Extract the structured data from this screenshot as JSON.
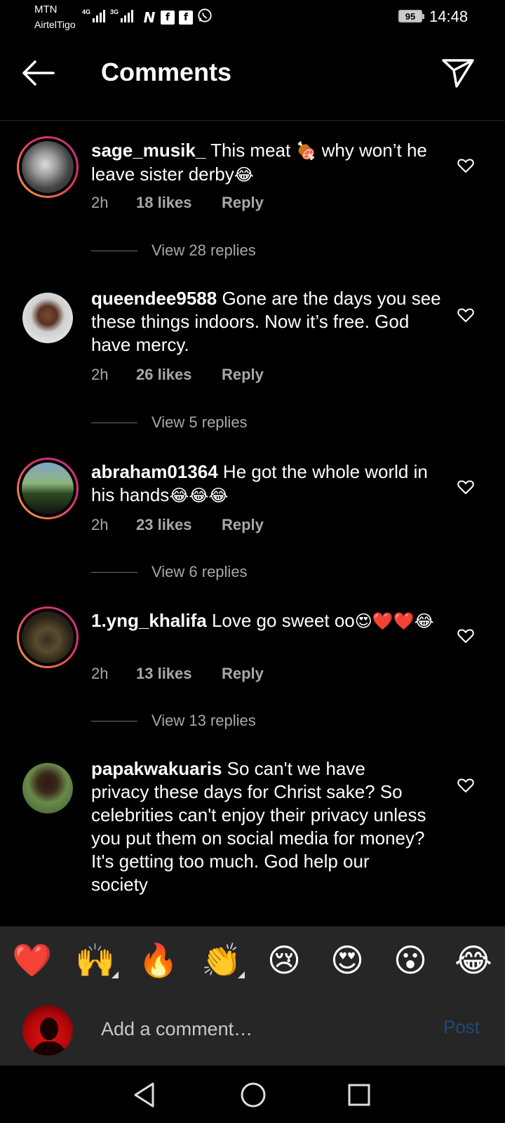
{
  "status": {
    "carrier1": "MTN",
    "carrier2": "AirtelTigo",
    "net1": "4G",
    "net2": "3G",
    "battery": "95",
    "time": "14:48",
    "app_icons": [
      "N",
      "f",
      "f",
      "whatsapp"
    ]
  },
  "header": {
    "title": "Comments"
  },
  "comments": [
    {
      "user": "sage_musik_",
      "text_a": " This meat ",
      "emoji_a": "🍖",
      "text_b": " why won’t he leave sister derby",
      "emoji_b": "😂",
      "time": "2h",
      "likes": "18 likes",
      "reply": "Reply",
      "view_replies": "View 28 replies",
      "ring": true
    },
    {
      "user": "queendee9588",
      "text_a": " Gone are the days you see  these things indoors. Now it’s free. God have mercy.",
      "time": "2h",
      "likes": "26 likes",
      "reply": "Reply",
      "view_replies": "View 5 replies",
      "ring": false
    },
    {
      "user": "abraham01364",
      "text_a": " He got the whole world in his hands",
      "emoji_a": "😂😂😂",
      "time": "2h",
      "likes": "23 likes",
      "reply": "Reply",
      "view_replies": "View 6 replies",
      "ring": true
    },
    {
      "user": "1.yng_khalifa",
      "text_a": " Love go sweet oo",
      "emoji_a": "😍❤️❤️😂",
      "time": "2h",
      "likes": "13 likes",
      "reply": "Reply",
      "view_replies": "View 13 replies",
      "ring": true
    },
    {
      "user": "papakwakuaris",
      "text_a": " So can't we have privacy these days for Christ sake? So celebrities can't enjoy their privacy unless you put them on social media for money? It's getting too much. God help our society",
      "ring": false
    }
  ],
  "reactions": [
    "❤️",
    "🙌",
    "🔥",
    "👏",
    "😢",
    "😍",
    "😮",
    "😂"
  ],
  "add_comment": {
    "placeholder": "Add a comment…",
    "post_label": "Post"
  },
  "colors": {
    "post_disabled": "#1c4a78",
    "bar_bg": "#262626",
    "muted_text": "#a8a8a8"
  }
}
